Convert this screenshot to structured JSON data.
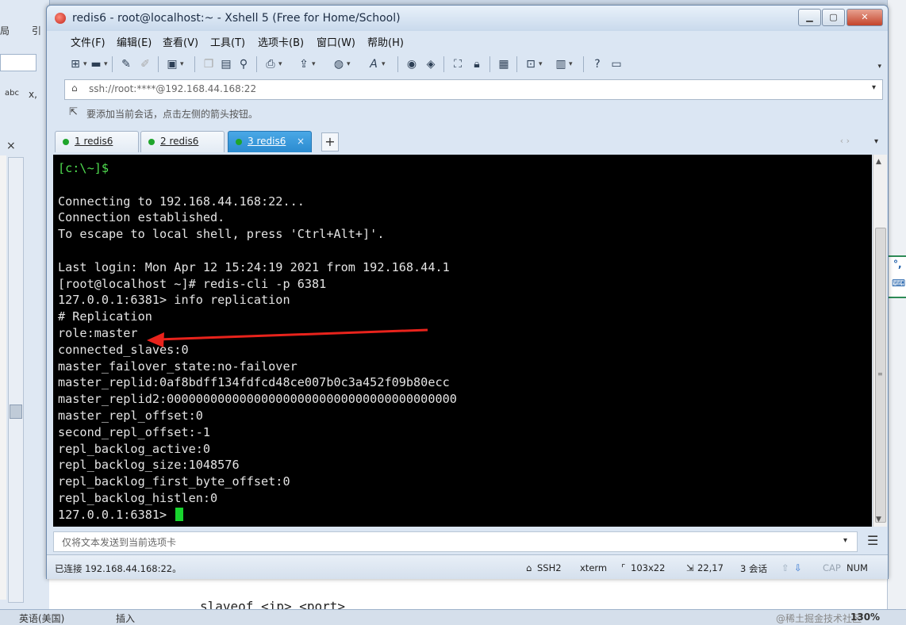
{
  "window": {
    "title": "redis6 - root@localhost:~ - Xshell 5 (Free for Home/School)",
    "min_label": "▭",
    "max_label": "▢",
    "close_label": "✕"
  },
  "menu": {
    "items": [
      "文件(F)",
      "编辑(E)",
      "查看(V)",
      "工具(T)",
      "选项卡(B)",
      "窗口(W)",
      "帮助(H)"
    ]
  },
  "toolbar": {
    "icons": [
      "new-session-icon",
      "open-folder-icon",
      "pencil-icon",
      "eraser-icon",
      "properties-icon",
      "copy-icon",
      "paste-icon",
      "find-icon",
      "print-icon",
      "transfer-icon",
      "globe-icon",
      "font-icon",
      "xftp-icon",
      "script-icon",
      "fullscreen-icon",
      "lock-icon",
      "keyboard-icon",
      "compose-icon",
      "layout-icon",
      "help-icon",
      "chat-icon"
    ]
  },
  "address": {
    "value": "ssh://root:****@192.168.44.168:22"
  },
  "hint": {
    "text": "要添加当前会话，点击左侧的箭头按钮。"
  },
  "tabs": [
    {
      "label": "1 redis6",
      "active": false
    },
    {
      "label": "2 redis6",
      "active": false
    },
    {
      "label": "3 redis6",
      "active": true
    }
  ],
  "tab_add": "+",
  "terminal": {
    "lines": [
      "[c:\\~]$",
      "",
      "Connecting to 192.168.44.168:22...",
      "Connection established.",
      "To escape to local shell, press 'Ctrl+Alt+]'.",
      "",
      "Last login: Mon Apr 12 15:24:19 2021 from 192.168.44.1",
      "[root@localhost ~]# redis-cli -p 6381",
      "127.0.0.1:6381> info replication",
      "# Replication",
      "role:master",
      "connected_slaves:0",
      "master_failover_state:no-failover",
      "master_replid:0af8bdff134fdfcd48ce007b0c3a452f09b80ecc",
      "master_replid2:0000000000000000000000000000000000000000",
      "master_repl_offset:0",
      "second_repl_offset:-1",
      "repl_backlog_active:0",
      "repl_backlog_size:1048576",
      "repl_backlog_first_byte_offset:0",
      "repl_backlog_histlen:0",
      "127.0.0.1:6381> "
    ],
    "arrow_color": "#e8231c",
    "cursor_color": "#18d42e"
  },
  "sendbar": {
    "placeholder": "仅将文本发送到当前选项卡"
  },
  "status": {
    "connection": "已连接 192.168.44.168:22。",
    "protocol": "SSH2",
    "term": "xterm",
    "size": "103x22",
    "cursor_pos": "22,17",
    "sessions": "3 会话",
    "cap": "CAP",
    "num": "NUM"
  },
  "background": {
    "ime_label": "英",
    "doc_code": "slaveof  <ip>  <port>",
    "lang": "英语(美国)",
    "insert": "插入",
    "zoom": "130%",
    "watermark": "@稀土掘金技术社区"
  }
}
